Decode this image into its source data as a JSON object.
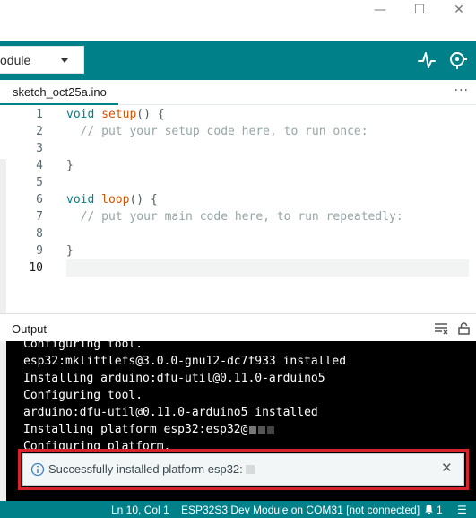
{
  "window": {
    "minimize_glyph": "—",
    "maximize_glyph": "☐",
    "close_glyph": "✕"
  },
  "toolbar": {
    "board_selector_text": "odule",
    "plotter_icon": "serial-plotter-icon",
    "monitor_icon": "serial-monitor-icon"
  },
  "tabs": {
    "active_label": "sketch_oct25a.ino",
    "more_label": "···"
  },
  "editor": {
    "line_numbers": [
      "1",
      "2",
      "3",
      "4",
      "5",
      "6",
      "7",
      "8",
      "9",
      "10"
    ],
    "lines": [
      {
        "kw": "void ",
        "fn": "setup",
        "rest": "() {",
        "cmt": ""
      },
      {
        "kw": "",
        "fn": "",
        "rest": "  ",
        "cmt": "// put your setup code here, to run once:"
      },
      {
        "kw": "",
        "fn": "",
        "rest": "",
        "cmt": ""
      },
      {
        "kw": "",
        "fn": "",
        "rest": "}",
        "cmt": ""
      },
      {
        "kw": "",
        "fn": "",
        "rest": "",
        "cmt": ""
      },
      {
        "kw": "void ",
        "fn": "loop",
        "rest": "() {",
        "cmt": ""
      },
      {
        "kw": "",
        "fn": "",
        "rest": "  ",
        "cmt": "// put your main code here, to run repeatedly:"
      },
      {
        "kw": "",
        "fn": "",
        "rest": "",
        "cmt": ""
      },
      {
        "kw": "",
        "fn": "",
        "rest": "}",
        "cmt": ""
      },
      {
        "kw": "",
        "fn": "",
        "rest": "",
        "cmt": ""
      }
    ]
  },
  "output": {
    "title": "Output",
    "lines": [
      "Configuring tool.",
      "esp32:mklittlefs@3.0.0-gnu12-dc7f933 installed",
      "Installing arduino:dfu-util@0.11.0-arduino5",
      "Configuring tool.",
      "arduino:dfu-util@0.11.0-arduino5 installed",
      "Installing platform esp32:esp32@",
      "Configuring platform."
    ]
  },
  "notification": {
    "message": "Successfully installed platform esp32:",
    "close_glyph": "✕"
  },
  "statusbar": {
    "position": "Ln 10, Col 1",
    "board": "ESP32S3 Dev Module on COM31 [not connected]",
    "notification_count": "1",
    "more": "☰"
  },
  "colors": {
    "accent": "#00818a",
    "highlight_outline": "#d8232a"
  }
}
